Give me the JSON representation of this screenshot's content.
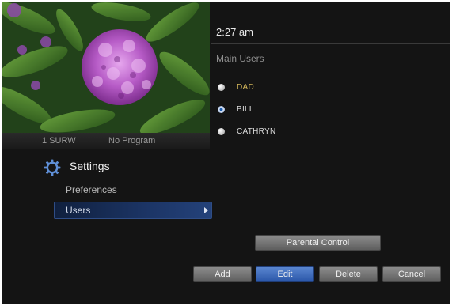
{
  "preview": {
    "channel_number": "1  SURW",
    "program": "No Program"
  },
  "clock": {
    "time": "2:27 am"
  },
  "users_panel": {
    "section_title": "Main Users",
    "users": [
      {
        "name": "DAD",
        "selected": false
      },
      {
        "name": "BILL",
        "selected": true
      },
      {
        "name": "CATHRYN",
        "selected": false
      }
    ]
  },
  "settings_menu": {
    "title": "Settings",
    "items": [
      {
        "label": "Preferences"
      },
      {
        "label": "Users"
      }
    ]
  },
  "buttons": {
    "parental_control": "Parental Control",
    "add": "Add",
    "edit": "Edit",
    "delete": "Delete",
    "cancel": "Cancel"
  },
  "colors": {
    "background": "#141414",
    "highlight_text": "#d6b85a",
    "accent_blue": "#2a56a8"
  },
  "icons": {
    "settings": "gear-icon",
    "submenu": "chevron-right-icon"
  }
}
